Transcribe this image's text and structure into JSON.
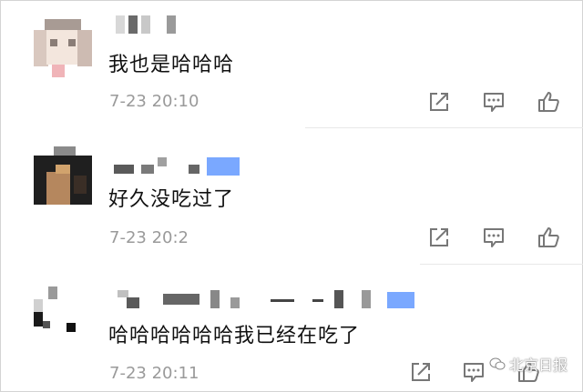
{
  "comments": [
    {
      "text": "我也是哈哈哈",
      "time": "7-23 20:10"
    },
    {
      "text": "好久没吃过了",
      "time": "7-23 20:2"
    },
    {
      "text": "哈哈哈哈哈哈我已经在吃了",
      "time": "7-23 20:11"
    }
  ],
  "watermark": {
    "text": "北京日报"
  },
  "colors": {
    "icon": "#777777",
    "time": "#9a9a9a",
    "text": "#111111"
  }
}
